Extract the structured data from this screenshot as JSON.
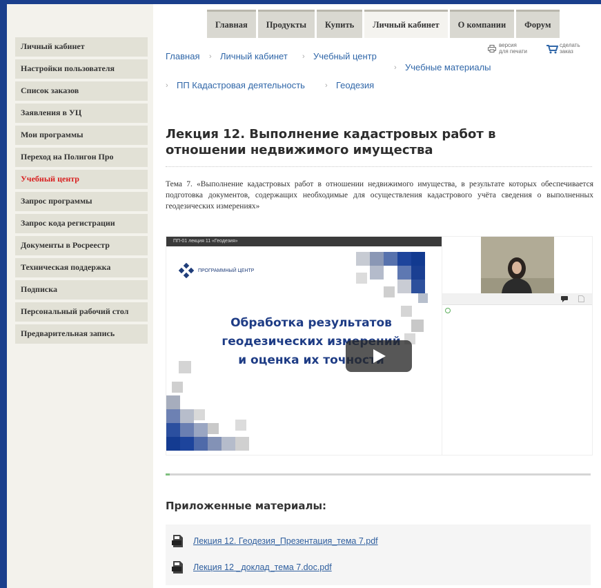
{
  "topnav": [
    "Главная",
    "Продукты",
    "Купить",
    "Личный кабинет",
    "О компании",
    "Форум"
  ],
  "sidebar": [
    "Личный кабинет",
    "Настройки пользователя",
    "Список заказов",
    "Заявления в УЦ",
    "Мои программы",
    "Переход на Полигон Про",
    "Учебный центр",
    "Запрос программы",
    "Запрос кода регистрации",
    "Документы в Росреестр",
    "Техническая поддержка",
    "Подписка",
    "Персональный рабочий стол",
    "Предварительная запись"
  ],
  "breadcrumb": [
    "Главная",
    "Личный кабинет",
    "Учебный центр",
    "Учебные материалы",
    "ПП Кадастровая деятельность",
    "Геодезия"
  ],
  "tools": {
    "print_line1": "версия",
    "print_line2": "для печати",
    "order_line1": "сделать",
    "order_line2": "заказ"
  },
  "title": "Лекция 12. Выполнение кадастровых работ в отношении недвижимого имущества",
  "topic": "Тема 7. «Выполнение кадастровых работ в отношении недвижимого имущества, в результате которых обеспечивается подготовка документов, содержащих необходимые для осуществления кадастрового учёта сведения о выполненных геодезических измерениях»",
  "video": {
    "bar_text": "ПП-01 лекция 11 «Геодезия»",
    "brand": "ПРОГРАММНЫЙ ЦЕНТР",
    "heading_1": "Обработка результатов",
    "heading_2": "геодезических измерений",
    "heading_3": "и оценка их точности",
    "progress": 0.01
  },
  "materials_title": "Приложенные материалы:",
  "files": [
    "Лекция 12. Геодезия_Презентация_тема 7.pdf",
    "Лекция 12 _доклад_тема 7.doc.pdf"
  ]
}
